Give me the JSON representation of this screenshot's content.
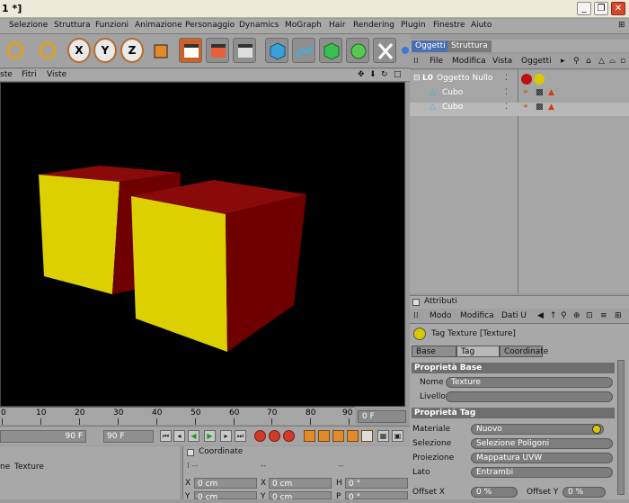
{
  "window": {
    "title": "1 *]",
    "buttons": [
      "_",
      "❐",
      "✕"
    ]
  },
  "menubar": [
    "Selezione",
    "Struttura",
    "Funzioni",
    "Animazione",
    "Personaggio",
    "Dynamics",
    "MoGraph",
    "Hair",
    "Rendering",
    "Plugin",
    "Finestre",
    "Aiuto"
  ],
  "toolbar": {
    "axis_labels": [
      "X",
      "Y",
      "Z"
    ]
  },
  "viewport": {
    "menu": [
      "ste",
      "Fitri",
      "Viste"
    ]
  },
  "timeline": {
    "ticks": [
      "0",
      "10",
      "20",
      "30",
      "40",
      "50",
      "60",
      "70",
      "80",
      "90"
    ],
    "current_frame": "0 F",
    "end_frame_field": "90 F",
    "end_frame_field2": "90 F"
  },
  "materials_panel": {
    "menu": [
      "ne",
      "Texture"
    ]
  },
  "coordinates": {
    "title": "Coordinate",
    "rows": [
      {
        "a": "X",
        "av": "0 cm",
        "b": "X",
        "bv": "0 cm",
        "c": "H",
        "cv": "0 °"
      },
      {
        "a": "Y",
        "av": "0 cm",
        "b": "Y",
        "bv": "0 cm",
        "c": "P",
        "cv": "0 °"
      }
    ]
  },
  "object_manager": {
    "tabs": [
      "Oggetti",
      "Struttura"
    ],
    "menu": [
      "File",
      "Modifica",
      "Vista",
      "Oggetti"
    ],
    "tree": [
      {
        "label": "Oggetto Nullo",
        "indent": 0
      },
      {
        "label": "Cubo",
        "indent": 1
      },
      {
        "label": "Cubo",
        "indent": 1
      }
    ]
  },
  "attributes": {
    "title": "Attributi",
    "menu": [
      "Modo",
      "Modifica",
      "Dati U"
    ],
    "header": "Tag Texture [Texture]",
    "tabs": [
      "Base",
      "Tag",
      "Coordinate"
    ],
    "base_section": "Proprietà Base",
    "name_label": "Nome",
    "name_value": "Texture",
    "layer_label": "Livello",
    "tag_section": "Proprietà Tag",
    "material_label": "Materiale",
    "material_value": "Nuovo",
    "selection_label": "Selezione",
    "selection_value": "Selezione Poligoni",
    "projection_label": "Proiezione",
    "projection_value": "Mappatura UVW",
    "side_label": "Lato",
    "side_value": "Entrambi",
    "offset_x_label": "Offset X",
    "offset_x_value": "0 %",
    "offset_y_label": "Offset Y",
    "offset_y_value": "0 %"
  },
  "colors": {
    "cube_front": "#dcd000",
    "cube_side": "#6e0000",
    "cube_top": "#8a0a0a",
    "ui_gray": "#a8a8a8"
  }
}
